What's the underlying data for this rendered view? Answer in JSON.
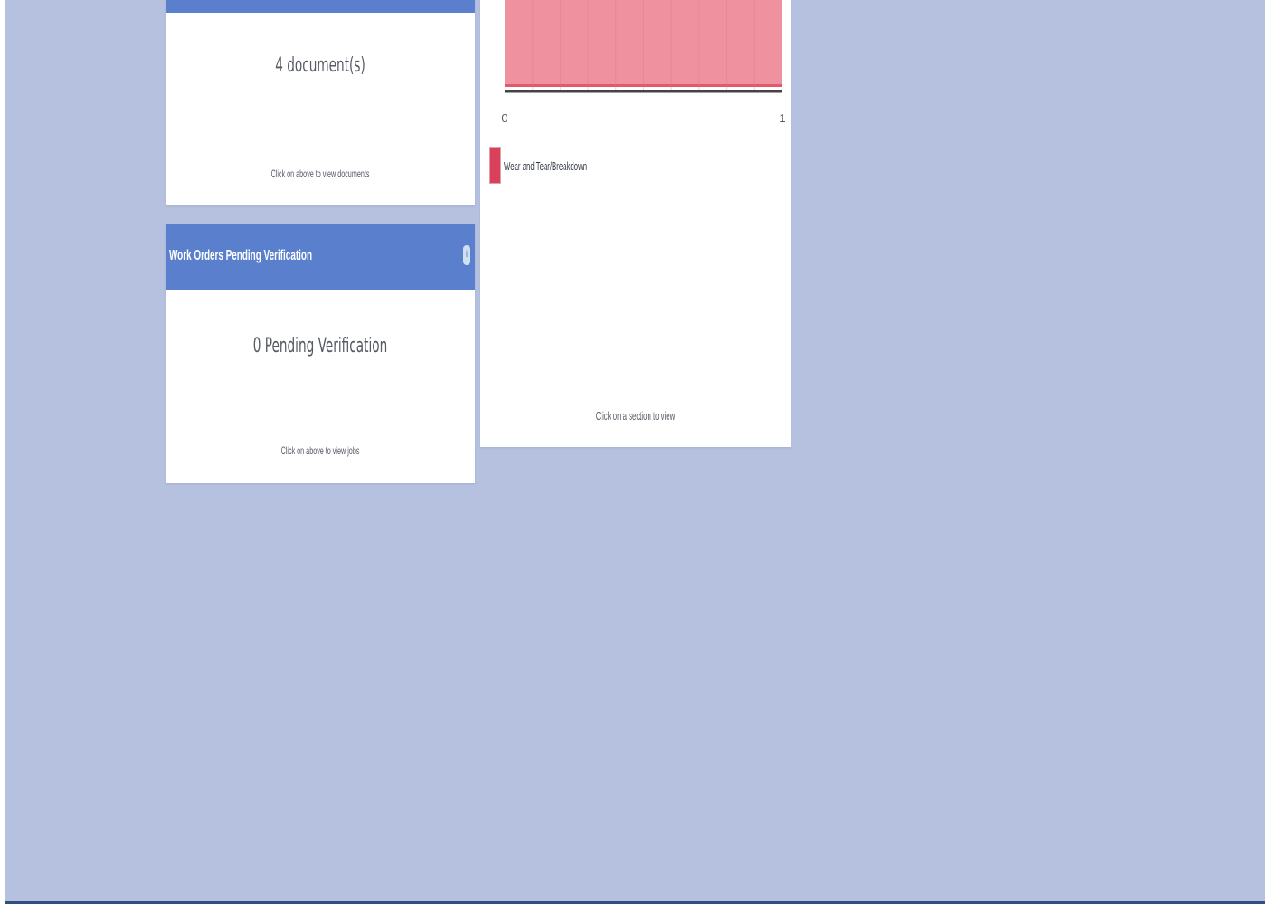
{
  "documents_card": {
    "count_text": "4 document(s)",
    "hint": "Click on above to view documents"
  },
  "pending_card": {
    "title": "Work Orders Pending Verification",
    "info_icon": "info-icon",
    "count_text": "0 Pending Verification",
    "hint": "Click on above to view jobs"
  },
  "chart_card": {
    "hint": "Click on a section to view"
  },
  "colors": {
    "page_bg": "#b6c1df",
    "header_bg": "#5a80cd",
    "bar_fill": "#f0919f",
    "legend_swatch": "#d9415b"
  },
  "chart_data": {
    "type": "bar",
    "orientation": "horizontal",
    "categories": [
      "Wear and Tear/Breakdown"
    ],
    "series": [
      {
        "name": "Wear and Tear/Breakdown",
        "values": [
          1
        ]
      }
    ],
    "xlim": [
      0,
      1
    ],
    "x_ticks": [
      "0",
      "1"
    ],
    "legend": "bottom-left",
    "grid": true
  }
}
